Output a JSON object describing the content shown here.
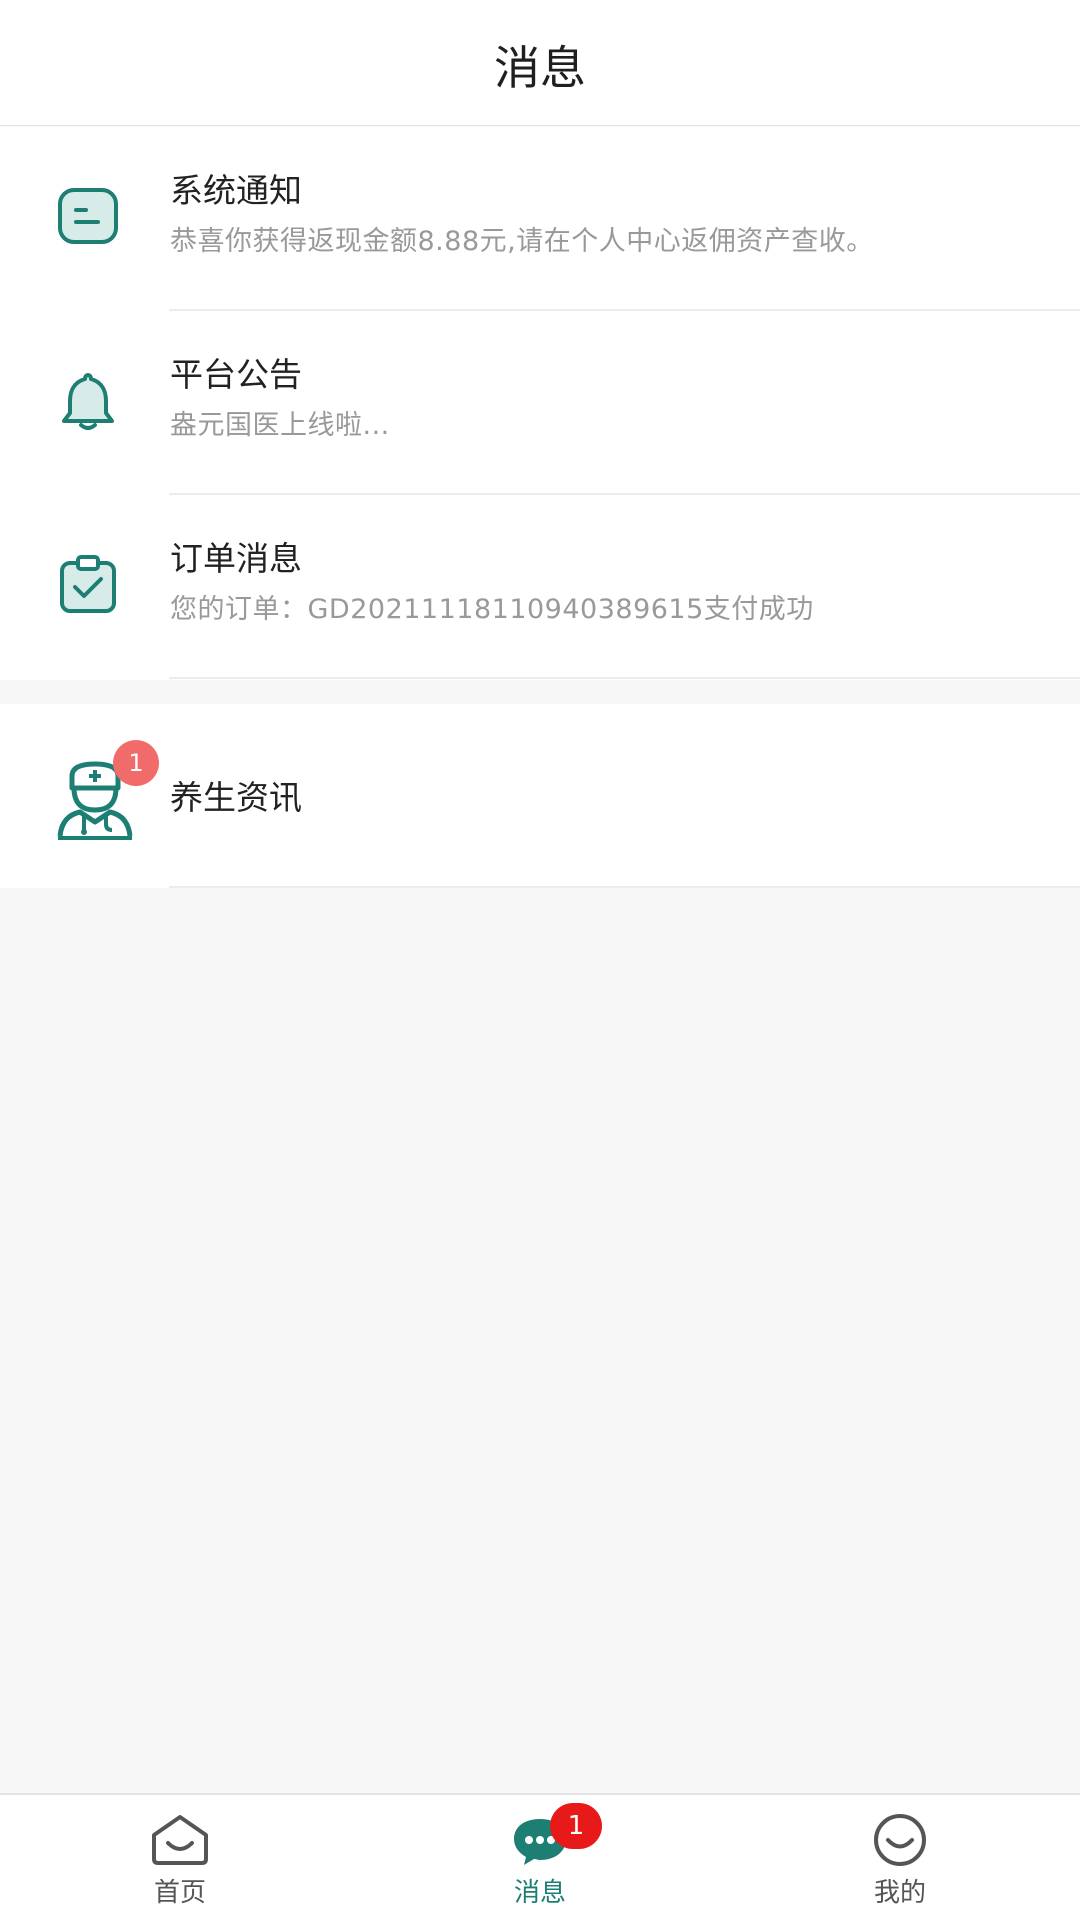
{
  "header": {
    "title": "消息"
  },
  "messages": [
    {
      "title": "系统通知",
      "subtitle": "恭喜你获得返现金额8.88元,请在个人中心返佣资产查收。",
      "icon": "notice-icon"
    },
    {
      "title": "平台公告",
      "subtitle": "盎元国医上线啦...",
      "icon": "bell-icon"
    },
    {
      "title": "订单消息",
      "subtitle": "您的订单：GD20211118110940389615支付成功",
      "icon": "clipboard-check-icon"
    }
  ],
  "health": {
    "title": "养生资讯",
    "badge": "1",
    "icon": "doctor-icon"
  },
  "tabbar": {
    "items": [
      {
        "label": "首页",
        "icon": "home-icon"
      },
      {
        "label": "消息",
        "icon": "chat-icon",
        "badge": "1"
      },
      {
        "label": "我的",
        "icon": "smile-icon"
      }
    ],
    "active_index": 1
  },
  "colors": {
    "accent": "#1d7f73",
    "badge_red": "#e81919",
    "badge_soft_red": "#f26b6b"
  }
}
